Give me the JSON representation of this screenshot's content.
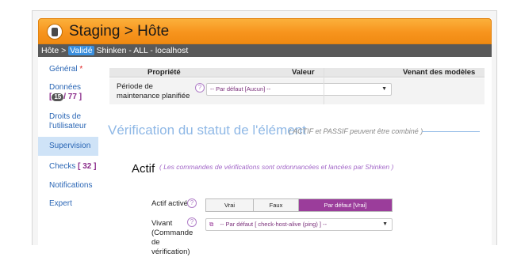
{
  "header": {
    "title": "Staging > Hôte"
  },
  "breadcrumb": {
    "prefix": "Hôte >",
    "status": "Validé",
    "item": "Shinken - ALL - localhost"
  },
  "sidebar": {
    "general": {
      "label": "Général",
      "required": "*"
    },
    "donnees": {
      "label": "Données",
      "badge": "15",
      "count": "/ 77 ]",
      "open": "["
    },
    "droits": {
      "label": "Droits de l'utilisateur"
    },
    "supervision": {
      "label": "Supervision"
    },
    "checks": {
      "label": "Checks",
      "count": "[ 32 ]"
    },
    "notifications": {
      "label": "Notifications"
    },
    "expert": {
      "label": "Expert"
    }
  },
  "table": {
    "headers": {
      "property": "Propriété",
      "value": "Valeur",
      "from_models": "Venant des modèles"
    },
    "maintenance": {
      "label": "Période de maintenance planifiée",
      "help": "?",
      "select_value": "-- Par défaut [Aucun] --"
    }
  },
  "section": {
    "title": "Vérification du statut de l'élément",
    "subtitle": "( ACTIF et PASSIF peuvent être combiné )"
  },
  "actif": {
    "title": "Actif",
    "subtitle": "( Les commandes de vérifications sont ordonnancées et lancées par Shinken )",
    "enabled": {
      "label": "Actif activé",
      "help": "?",
      "options": [
        "Vrai",
        "Faux",
        "Par défaut [Vrai]"
      ],
      "selected": "Par défaut [Vrai]"
    },
    "vivant": {
      "label": "Vivant (Commande de vérification)",
      "help": "?",
      "select_value": "-- Par défaut [ check-host-alive (ping) ] --"
    }
  },
  "icons": {
    "logo": "database-icon",
    "help": "question-icon",
    "external_link": "external-link-icon",
    "caret": "chevron-down-icon"
  },
  "colors": {
    "header": "#f7941d",
    "selected_option": "#9b3d9b",
    "section_title": "#8fb8e6",
    "active_sidebar": "#cfe3f7"
  }
}
